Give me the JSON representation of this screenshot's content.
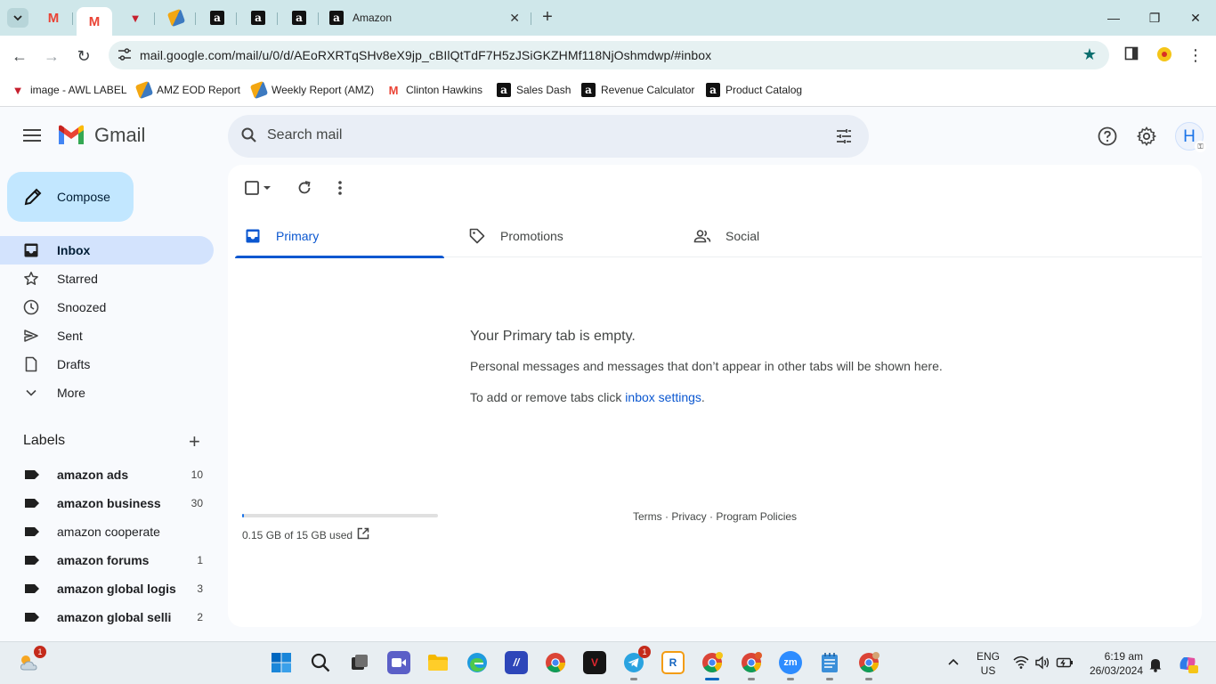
{
  "browser": {
    "tabs": [
      {
        "favicon": "gmail-icon"
      },
      {
        "favicon": "gmail-icon",
        "active": true
      },
      {
        "favicon": "red-v-icon"
      },
      {
        "favicon": "zap-icon"
      },
      {
        "favicon": "amazon-icon"
      },
      {
        "favicon": "amazon-icon"
      },
      {
        "favicon": "amazon-icon"
      },
      {
        "favicon": "amazon-icon",
        "title": "Amazon"
      }
    ],
    "amazon_tab_title": "Amazon",
    "url": "mail.google.com/mail/u/0/d/AEoRXRTqSHv8eX9jp_cBIlQtTdF7H5zJSiGKZHMf118NjOshmdwp/#inbox",
    "bookmarks": [
      {
        "label": "image - AWL LABEL",
        "icon": "red-v-icon"
      },
      {
        "label": "AMZ EOD Report",
        "icon": "zap-icon"
      },
      {
        "label": "Weekly Report (AMZ)",
        "icon": "zap-icon"
      },
      {
        "label": "Clinton Hawkins",
        "icon": "gmail-icon"
      },
      {
        "label": "Sales Dash",
        "icon": "amazon-icon"
      },
      {
        "label": "Revenue Calculator",
        "icon": "amazon-icon"
      },
      {
        "label": "Product Catalog",
        "icon": "amazon-icon"
      }
    ]
  },
  "gmail": {
    "brand": "Gmail",
    "search_placeholder": "Search mail",
    "avatar_letter": "H",
    "compose_label": "Compose",
    "nav": [
      {
        "label": "Inbox",
        "icon": "inbox-icon",
        "active": true
      },
      {
        "label": "Starred",
        "icon": "star-icon"
      },
      {
        "label": "Snoozed",
        "icon": "clock-icon"
      },
      {
        "label": "Sent",
        "icon": "send-icon"
      },
      {
        "label": "Drafts",
        "icon": "draft-icon"
      },
      {
        "label": "More",
        "icon": "chevron-down-icon"
      }
    ],
    "labels_title": "Labels",
    "labels": [
      {
        "name": "amazon ads",
        "count": "10",
        "bold": true
      },
      {
        "name": "amazon business",
        "count": "30",
        "bold": true
      },
      {
        "name": "amazon cooperate",
        "count": "",
        "bold": false
      },
      {
        "name": "amazon forums",
        "count": "1",
        "bold": true
      },
      {
        "name": "amazon global logis",
        "count": "3",
        "bold": true
      },
      {
        "name": "amazon global selli",
        "count": "2",
        "bold": true
      }
    ],
    "tabs": [
      {
        "label": "Primary",
        "icon": "inbox-icon",
        "active": true
      },
      {
        "label": "Promotions",
        "icon": "tag-icon"
      },
      {
        "label": "Social",
        "icon": "people-icon"
      }
    ],
    "empty": {
      "title": "Your Primary tab is empty.",
      "description": "Personal messages and messages that don’t appear in other tabs will be shown here.",
      "add_prefix": "To add or remove tabs click ",
      "add_link": "inbox settings",
      "add_suffix": "."
    },
    "storage": {
      "text": "0.15 GB of 15 GB used",
      "used_fraction": 0.01
    },
    "footer": {
      "terms": "Terms",
      "privacy": "Privacy",
      "policies": "Program Policies",
      "sep": " · "
    }
  },
  "taskbar": {
    "weather_badge": "1",
    "telegram_badge": "1",
    "language": "ENG",
    "region": "US",
    "time": "6:19 am",
    "date": "26/03/2024"
  }
}
